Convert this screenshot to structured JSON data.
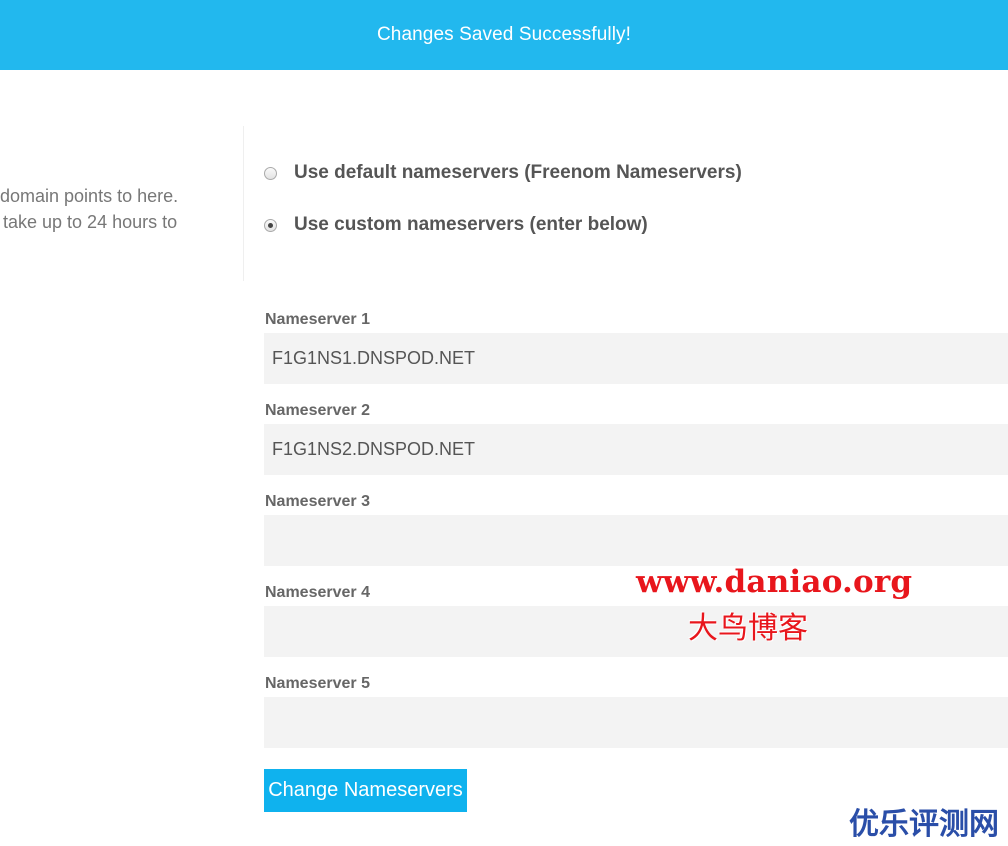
{
  "banner": {
    "message": "Changes Saved Successfully!"
  },
  "info": {
    "line1": "domain points to here.",
    "line2": "take up to 24 hours to"
  },
  "nameserver_options": {
    "default_label": "Use default nameservers (Freenom Nameservers)",
    "custom_label": "Use custom nameservers (enter below)",
    "selected": "custom"
  },
  "nameservers": [
    {
      "label": "Nameserver 1",
      "value": "F1G1NS1.DNSPOD.NET"
    },
    {
      "label": "Nameserver 2",
      "value": "F1G1NS2.DNSPOD.NET"
    },
    {
      "label": "Nameserver 3",
      "value": ""
    },
    {
      "label": "Nameserver 4",
      "value": ""
    },
    {
      "label": "Nameserver 5",
      "value": ""
    }
  ],
  "actions": {
    "submit_label": "Change Nameservers"
  },
  "watermarks": {
    "site": "www.daniao.org",
    "blog": "大鸟博客",
    "corner": "优乐评测网"
  },
  "colors": {
    "banner": "#22b8ee",
    "button": "#0fb2ee",
    "watermark_red": "#e8161c",
    "watermark_blue": "#2a4ea8"
  }
}
